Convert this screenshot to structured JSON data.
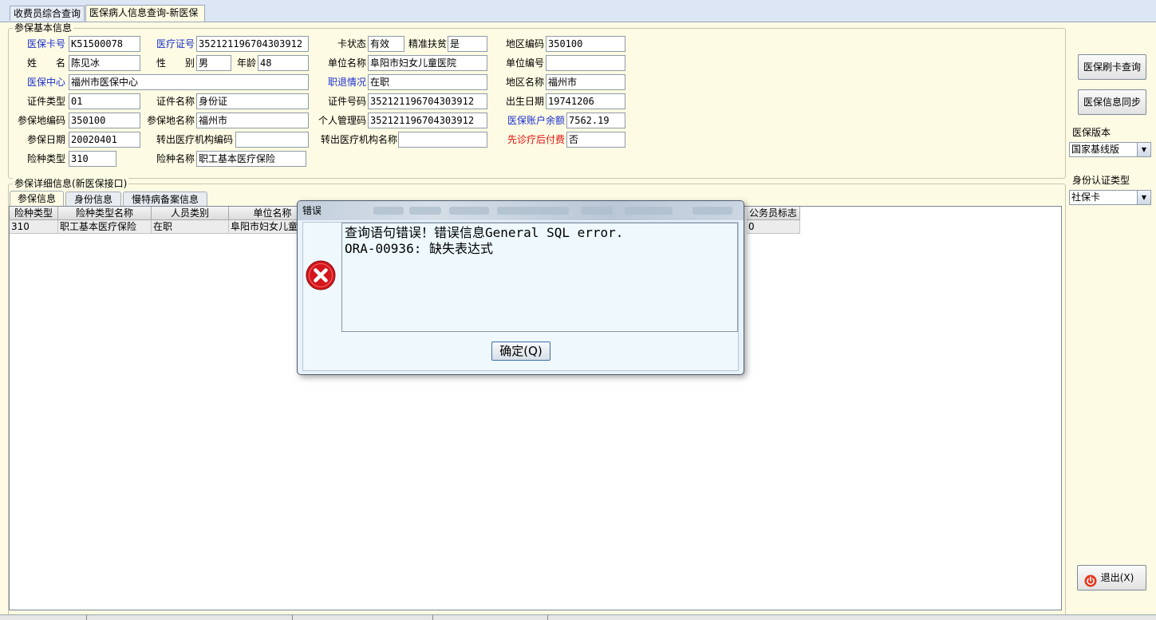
{
  "tabs": [
    {
      "label": "收费员综合查询",
      "active": false
    },
    {
      "label": "医保病人信息查询-新医保",
      "active": true
    }
  ],
  "basic_info": {
    "group_title": "参保基本信息",
    "fields": {
      "card_no": {
        "label": "医保卡号",
        "value": "K51500078"
      },
      "medical_cert": {
        "label": "医疗证号",
        "value": "352121196704303912"
      },
      "card_status": {
        "label": "卡状态",
        "value": "有效"
      },
      "poverty": {
        "label": "精准扶贫",
        "value": "是"
      },
      "region_code": {
        "label": "地区编码",
        "value": "350100"
      },
      "name": {
        "label": "姓　　名",
        "value": "陈见冰"
      },
      "gender": {
        "label": "性　　别",
        "value": "男"
      },
      "age": {
        "label": "年龄",
        "value": "48"
      },
      "unit_name": {
        "label": "单位名称",
        "value": "阜阳市妇女儿童医院"
      },
      "unit_no": {
        "label": "单位编号",
        "value": ""
      },
      "insurance_center": {
        "label": "医保中心",
        "value": "福州市医保中心"
      },
      "job_status": {
        "label": "职退情况",
        "value": "在职"
      },
      "region_name": {
        "label": "地区名称",
        "value": "福州市"
      },
      "id_type": {
        "label": "证件类型",
        "value": "01"
      },
      "id_name": {
        "label": "证件名称",
        "value": "身份证"
      },
      "id_no": {
        "label": "证件号码",
        "value": "352121196704303912"
      },
      "birth_date": {
        "label": "出生日期",
        "value": "19741206"
      },
      "place_code": {
        "label": "参保地编码",
        "value": "350100"
      },
      "place_name": {
        "label": "参保地名称",
        "value": "福州市"
      },
      "personal_code": {
        "label": "个人管理码",
        "value": "352121196704303912"
      },
      "account_balance": {
        "label": "医保账户余额",
        "value": "7562.19"
      },
      "insured_date": {
        "label": "参保日期",
        "value": "20020401"
      },
      "transfer_code": {
        "label": "转出医疗机构编码",
        "value": ""
      },
      "transfer_name": {
        "label": "转出医疗机构名称",
        "value": ""
      },
      "pay_after": {
        "label": "先诊疗后付费",
        "value": "否"
      },
      "ins_type": {
        "label": "险种类型",
        "value": "310"
      },
      "ins_type_name": {
        "label": "险种名称",
        "value": "职工基本医疗保险"
      }
    }
  },
  "right_panel": {
    "swipe_button": "医保刷卡查询",
    "sync_button": "医保信息同步",
    "version_label": "医保版本",
    "version_value": "国家基线版",
    "auth_label": "身份认证类型",
    "auth_value": "社保卡",
    "exit_button": "退出(X)"
  },
  "detail": {
    "group_title": "参保详细信息(新医保接口)",
    "tabs": [
      "参保信息",
      "身份信息",
      "慢特病备案信息"
    ],
    "columns": [
      "险种类型",
      "险种类型名称",
      "人员类别",
      "单位名称",
      "公务员标志"
    ],
    "row": [
      "310",
      "职工基本医疗保险",
      "在职",
      "阜阳市妇女儿童",
      "0"
    ]
  },
  "dialog": {
    "title": "错误",
    "message": "查询语句错误！错误信息General SQL error.\nORA-00936: 缺失表达式",
    "ok_button": "确定(Q)",
    "icon": "error-icon"
  },
  "colors": {
    "background": "#fdfbe3",
    "label_blue": "#1b2fd0",
    "label_red": "#e01010",
    "error_red": "#d4161c"
  }
}
